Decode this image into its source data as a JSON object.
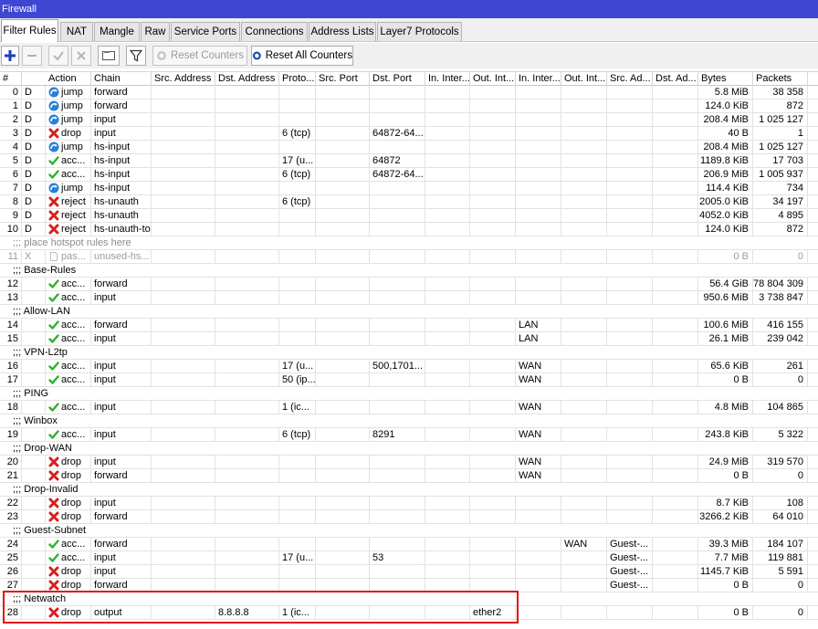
{
  "window": {
    "title": "Firewall"
  },
  "tabs": [
    {
      "label": "Filter Rules",
      "active": true
    },
    {
      "label": "NAT"
    },
    {
      "label": "Mangle"
    },
    {
      "label": "Raw"
    },
    {
      "label": "Service Ports"
    },
    {
      "label": "Connections"
    },
    {
      "label": "Address Lists"
    },
    {
      "label": "Layer7 Protocols"
    }
  ],
  "toolbar": {
    "add_icon": "plus-icon",
    "remove_icon": "minus-icon",
    "enable_icon": "check-icon",
    "disable_icon": "x-icon",
    "comment_icon": "comment-icon",
    "filter_icon": "filter-funnel-icon",
    "reset_counters_label": "Reset Counters",
    "reset_all_counters_label": "Reset All Counters"
  },
  "columns": [
    "#",
    "Action",
    "Chain",
    "Src. Address",
    "Dst. Address",
    "Proto...",
    "Src. Port",
    "Dst. Port",
    "In. Inter...",
    "Out. Int...",
    "In. Inter...",
    "Out. Int...",
    "Src. Ad...",
    "Dst. Ad...",
    "Bytes",
    "Packets"
  ],
  "colors": {
    "accept": "#2fb12f",
    "drop": "#d42020",
    "jump": "#2a7fd6",
    "highlight": "#e01010",
    "title_bar": "#3e46d2"
  },
  "rows": [
    {
      "num": "0",
      "flag": "D",
      "action": "jump",
      "icon": "jump-icon",
      "chain": "forward",
      "src_addr": "",
      "dst_addr": "",
      "proto": "",
      "src_port": "",
      "dst_port": "",
      "in_if": "",
      "out_if": "",
      "in_if_list": "",
      "out_if_list": "",
      "src_addr_list": "",
      "dst_addr_list": "",
      "bytes": "5.8 MiB",
      "packets": "38 358"
    },
    {
      "num": "1",
      "flag": "D",
      "action": "jump",
      "icon": "jump-icon",
      "chain": "forward",
      "src_addr": "",
      "dst_addr": "",
      "proto": "",
      "src_port": "",
      "dst_port": "",
      "in_if": "",
      "out_if": "",
      "in_if_list": "",
      "out_if_list": "",
      "src_addr_list": "",
      "dst_addr_list": "",
      "bytes": "124.0 KiB",
      "packets": "872"
    },
    {
      "num": "2",
      "flag": "D",
      "action": "jump",
      "icon": "jump-icon",
      "chain": "input",
      "src_addr": "",
      "dst_addr": "",
      "proto": "",
      "src_port": "",
      "dst_port": "",
      "in_if": "",
      "out_if": "",
      "in_if_list": "",
      "out_if_list": "",
      "src_addr_list": "",
      "dst_addr_list": "",
      "bytes": "208.4 MiB",
      "packets": "1 025 127"
    },
    {
      "num": "3",
      "flag": "D",
      "action": "drop",
      "icon": "drop-icon",
      "chain": "input",
      "src_addr": "",
      "dst_addr": "",
      "proto": "6 (tcp)",
      "src_port": "",
      "dst_port": "64872-64...",
      "in_if": "",
      "out_if": "",
      "in_if_list": "",
      "out_if_list": "",
      "src_addr_list": "",
      "dst_addr_list": "",
      "bytes": "40 B",
      "packets": "1"
    },
    {
      "num": "4",
      "flag": "D",
      "action": "jump",
      "icon": "jump-icon",
      "chain": "hs-input",
      "src_addr": "",
      "dst_addr": "",
      "proto": "",
      "src_port": "",
      "dst_port": "",
      "in_if": "",
      "out_if": "",
      "in_if_list": "",
      "out_if_list": "",
      "src_addr_list": "",
      "dst_addr_list": "",
      "bytes": "208.4 MiB",
      "packets": "1 025 127"
    },
    {
      "num": "5",
      "flag": "D",
      "action": "acc...",
      "icon": "accept-icon",
      "chain": "hs-input",
      "src_addr": "",
      "dst_addr": "",
      "proto": "17 (u...",
      "src_port": "",
      "dst_port": "64872",
      "in_if": "",
      "out_if": "",
      "in_if_list": "",
      "out_if_list": "",
      "src_addr_list": "",
      "dst_addr_list": "",
      "bytes": "1189.8 KiB",
      "packets": "17 703"
    },
    {
      "num": "6",
      "flag": "D",
      "action": "acc...",
      "icon": "accept-icon",
      "chain": "hs-input",
      "src_addr": "",
      "dst_addr": "",
      "proto": "6 (tcp)",
      "src_port": "",
      "dst_port": "64872-64...",
      "in_if": "",
      "out_if": "",
      "in_if_list": "",
      "out_if_list": "",
      "src_addr_list": "",
      "dst_addr_list": "",
      "bytes": "206.9 MiB",
      "packets": "1 005 937"
    },
    {
      "num": "7",
      "flag": "D",
      "action": "jump",
      "icon": "jump-icon",
      "chain": "hs-input",
      "src_addr": "",
      "dst_addr": "",
      "proto": "",
      "src_port": "",
      "dst_port": "",
      "in_if": "",
      "out_if": "",
      "in_if_list": "",
      "out_if_list": "",
      "src_addr_list": "",
      "dst_addr_list": "",
      "bytes": "114.4 KiB",
      "packets": "734"
    },
    {
      "num": "8",
      "flag": "D",
      "action": "reject",
      "icon": "drop-icon",
      "chain": "hs-unauth",
      "src_addr": "",
      "dst_addr": "",
      "proto": "6 (tcp)",
      "src_port": "",
      "dst_port": "",
      "in_if": "",
      "out_if": "",
      "in_if_list": "",
      "out_if_list": "",
      "src_addr_list": "",
      "dst_addr_list": "",
      "bytes": "2005.0 KiB",
      "packets": "34 197"
    },
    {
      "num": "9",
      "flag": "D",
      "action": "reject",
      "icon": "drop-icon",
      "chain": "hs-unauth",
      "src_addr": "",
      "dst_addr": "",
      "proto": "",
      "src_port": "",
      "dst_port": "",
      "in_if": "",
      "out_if": "",
      "in_if_list": "",
      "out_if_list": "",
      "src_addr_list": "",
      "dst_addr_list": "",
      "bytes": "4052.0 KiB",
      "packets": "4 895"
    },
    {
      "num": "10",
      "flag": "D",
      "action": "reject",
      "icon": "drop-icon",
      "chain": "hs-unauth-to",
      "src_addr": "",
      "dst_addr": "",
      "proto": "",
      "src_port": "",
      "dst_port": "",
      "in_if": "",
      "out_if": "",
      "in_if_list": "",
      "out_if_list": "",
      "src_addr_list": "",
      "dst_addr_list": "",
      "bytes": "124.0 KiB",
      "packets": "872"
    },
    {
      "comment": ";;; place hotspot rules here",
      "grey": true
    },
    {
      "num": "11",
      "flag": "X",
      "action": "pas...",
      "icon": "passthrough-icon",
      "chain": "unused-hs...",
      "src_addr": "",
      "dst_addr": "",
      "proto": "",
      "src_port": "",
      "dst_port": "",
      "in_if": "",
      "out_if": "",
      "in_if_list": "",
      "out_if_list": "",
      "src_addr_list": "",
      "dst_addr_list": "",
      "bytes": "0 B",
      "packets": "0",
      "disabled": true
    },
    {
      "comment": ";;; Base-Rules"
    },
    {
      "num": "12",
      "flag": "",
      "action": "acc...",
      "icon": "accept-icon",
      "chain": "forward",
      "src_addr": "",
      "dst_addr": "",
      "proto": "",
      "src_port": "",
      "dst_port": "",
      "in_if": "",
      "out_if": "",
      "in_if_list": "",
      "out_if_list": "",
      "src_addr_list": "",
      "dst_addr_list": "",
      "bytes": "56.4 GiB",
      "packets": "78 804 309"
    },
    {
      "num": "13",
      "flag": "",
      "action": "acc...",
      "icon": "accept-icon",
      "chain": "input",
      "src_addr": "",
      "dst_addr": "",
      "proto": "",
      "src_port": "",
      "dst_port": "",
      "in_if": "",
      "out_if": "",
      "in_if_list": "",
      "out_if_list": "",
      "src_addr_list": "",
      "dst_addr_list": "",
      "bytes": "950.6 MiB",
      "packets": "3 738 847"
    },
    {
      "comment": ";;; Allow-LAN"
    },
    {
      "num": "14",
      "flag": "",
      "action": "acc...",
      "icon": "accept-icon",
      "chain": "forward",
      "src_addr": "",
      "dst_addr": "",
      "proto": "",
      "src_port": "",
      "dst_port": "",
      "in_if": "",
      "out_if": "",
      "in_if_list": "LAN",
      "out_if_list": "",
      "src_addr_list": "",
      "dst_addr_list": "",
      "bytes": "100.6 MiB",
      "packets": "416 155"
    },
    {
      "num": "15",
      "flag": "",
      "action": "acc...",
      "icon": "accept-icon",
      "chain": "input",
      "src_addr": "",
      "dst_addr": "",
      "proto": "",
      "src_port": "",
      "dst_port": "",
      "in_if": "",
      "out_if": "",
      "in_if_list": "LAN",
      "out_if_list": "",
      "src_addr_list": "",
      "dst_addr_list": "",
      "bytes": "26.1 MiB",
      "packets": "239 042"
    },
    {
      "comment": ";;; VPN-L2tp"
    },
    {
      "num": "16",
      "flag": "",
      "action": "acc...",
      "icon": "accept-icon",
      "chain": "input",
      "src_addr": "",
      "dst_addr": "",
      "proto": "17 (u...",
      "src_port": "",
      "dst_port": "500,1701...",
      "in_if": "",
      "out_if": "",
      "in_if_list": "WAN",
      "out_if_list": "",
      "src_addr_list": "",
      "dst_addr_list": "",
      "bytes": "65.6 KiB",
      "packets": "261"
    },
    {
      "num": "17",
      "flag": "",
      "action": "acc...",
      "icon": "accept-icon",
      "chain": "input",
      "src_addr": "",
      "dst_addr": "",
      "proto": "50 (ip...",
      "src_port": "",
      "dst_port": "",
      "in_if": "",
      "out_if": "",
      "in_if_list": "WAN",
      "out_if_list": "",
      "src_addr_list": "",
      "dst_addr_list": "",
      "bytes": "0 B",
      "packets": "0"
    },
    {
      "comment": ";;; PING"
    },
    {
      "num": "18",
      "flag": "",
      "action": "acc...",
      "icon": "accept-icon",
      "chain": "input",
      "src_addr": "",
      "dst_addr": "",
      "proto": "1 (ic...",
      "src_port": "",
      "dst_port": "",
      "in_if": "",
      "out_if": "",
      "in_if_list": "WAN",
      "out_if_list": "",
      "src_addr_list": "",
      "dst_addr_list": "",
      "bytes": "4.8 MiB",
      "packets": "104 865"
    },
    {
      "comment": ";;; Winbox"
    },
    {
      "num": "19",
      "flag": "",
      "action": "acc...",
      "icon": "accept-icon",
      "chain": "input",
      "src_addr": "",
      "dst_addr": "",
      "proto": "6 (tcp)",
      "src_port": "",
      "dst_port": "8291",
      "in_if": "",
      "out_if": "",
      "in_if_list": "WAN",
      "out_if_list": "",
      "src_addr_list": "",
      "dst_addr_list": "",
      "bytes": "243.8 KiB",
      "packets": "5 322"
    },
    {
      "comment": ";;; Drop-WAN"
    },
    {
      "num": "20",
      "flag": "",
      "action": "drop",
      "icon": "drop-icon",
      "chain": "input",
      "src_addr": "",
      "dst_addr": "",
      "proto": "",
      "src_port": "",
      "dst_port": "",
      "in_if": "",
      "out_if": "",
      "in_if_list": "WAN",
      "out_if_list": "",
      "src_addr_list": "",
      "dst_addr_list": "",
      "bytes": "24.9 MiB",
      "packets": "319 570"
    },
    {
      "num": "21",
      "flag": "",
      "action": "drop",
      "icon": "drop-icon",
      "chain": "forward",
      "src_addr": "",
      "dst_addr": "",
      "proto": "",
      "src_port": "",
      "dst_port": "",
      "in_if": "",
      "out_if": "",
      "in_if_list": "WAN",
      "out_if_list": "",
      "src_addr_list": "",
      "dst_addr_list": "",
      "bytes": "0 B",
      "packets": "0"
    },
    {
      "comment": ";;; Drop-Invalid"
    },
    {
      "num": "22",
      "flag": "",
      "action": "drop",
      "icon": "drop-icon",
      "chain": "input",
      "src_addr": "",
      "dst_addr": "",
      "proto": "",
      "src_port": "",
      "dst_port": "",
      "in_if": "",
      "out_if": "",
      "in_if_list": "",
      "out_if_list": "",
      "src_addr_list": "",
      "dst_addr_list": "",
      "bytes": "8.7 KiB",
      "packets": "108"
    },
    {
      "num": "23",
      "flag": "",
      "action": "drop",
      "icon": "drop-icon",
      "chain": "forward",
      "src_addr": "",
      "dst_addr": "",
      "proto": "",
      "src_port": "",
      "dst_port": "",
      "in_if": "",
      "out_if": "",
      "in_if_list": "",
      "out_if_list": "",
      "src_addr_list": "",
      "dst_addr_list": "",
      "bytes": "3266.2 KiB",
      "packets": "64 010"
    },
    {
      "comment": ";;; Guest-Subnet"
    },
    {
      "num": "24",
      "flag": "",
      "action": "acc...",
      "icon": "accept-icon",
      "chain": "forward",
      "src_addr": "",
      "dst_addr": "",
      "proto": "",
      "src_port": "",
      "dst_port": "",
      "in_if": "",
      "out_if": "",
      "in_if_list": "",
      "out_if_list": "WAN",
      "src_addr_list": "Guest-...",
      "dst_addr_list": "",
      "bytes": "39.3 MiB",
      "packets": "184 107"
    },
    {
      "num": "25",
      "flag": "",
      "action": "acc...",
      "icon": "accept-icon",
      "chain": "input",
      "src_addr": "",
      "dst_addr": "",
      "proto": "17 (u...",
      "src_port": "",
      "dst_port": "53",
      "in_if": "",
      "out_if": "",
      "in_if_list": "",
      "out_if_list": "",
      "src_addr_list": "Guest-...",
      "dst_addr_list": "",
      "bytes": "7.7 MiB",
      "packets": "119 881"
    },
    {
      "num": "26",
      "flag": "",
      "action": "drop",
      "icon": "drop-icon",
      "chain": "input",
      "src_addr": "",
      "dst_addr": "",
      "proto": "",
      "src_port": "",
      "dst_port": "",
      "in_if": "",
      "out_if": "",
      "in_if_list": "",
      "out_if_list": "",
      "src_addr_list": "Guest-...",
      "dst_addr_list": "",
      "bytes": "1145.7 KiB",
      "packets": "5 591"
    },
    {
      "num": "27",
      "flag": "",
      "action": "drop",
      "icon": "drop-icon",
      "chain": "forward",
      "src_addr": "",
      "dst_addr": "",
      "proto": "",
      "src_port": "",
      "dst_port": "",
      "in_if": "",
      "out_if": "",
      "in_if_list": "",
      "out_if_list": "",
      "src_addr_list": "Guest-...",
      "dst_addr_list": "",
      "bytes": "0 B",
      "packets": "0"
    },
    {
      "comment": ";;; Netwatch"
    },
    {
      "num": "28",
      "flag": "",
      "action": "drop",
      "icon": "drop-icon",
      "chain": "output",
      "src_addr": "",
      "dst_addr": "8.8.8.8",
      "proto": "1 (ic...",
      "src_port": "",
      "dst_port": "",
      "in_if": "",
      "out_if": "ether2",
      "in_if_list": "",
      "out_if_list": "",
      "src_addr_list": "",
      "dst_addr_list": "",
      "bytes": "0 B",
      "packets": "0"
    }
  ]
}
